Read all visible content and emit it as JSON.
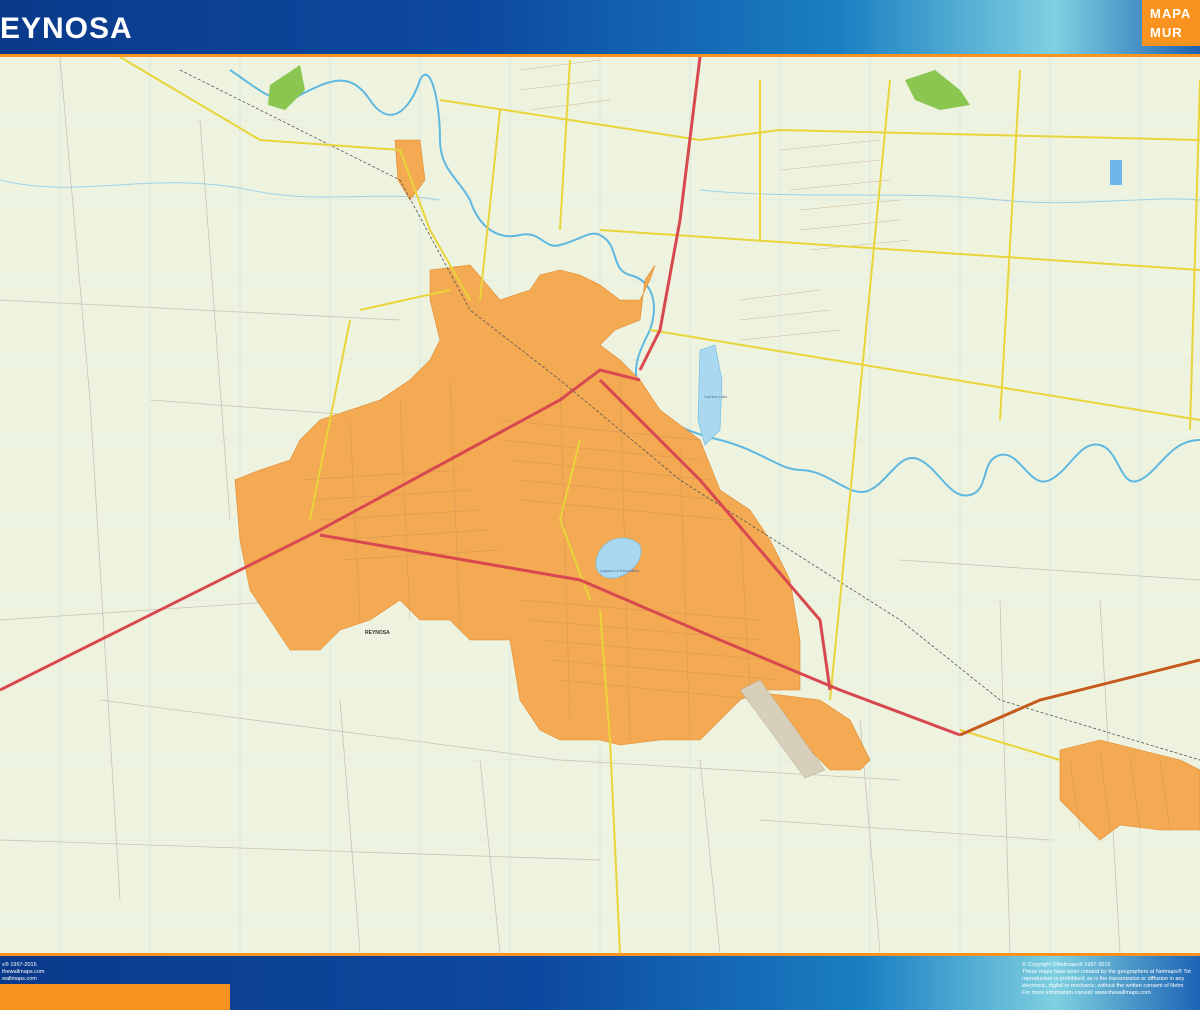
{
  "header": {
    "title": "EYNOSA",
    "brand_line1": "MAPA",
    "brand_line2": "MUR"
  },
  "map": {
    "labels": {
      "city": "REYNOSA",
      "lake": "Laguna La Escondida",
      "lake_north": "Carrera Lake"
    }
  },
  "footer": {
    "left_lines": [
      "s® 1997-2015",
      "thewallmaps.com",
      "wallmaps.com"
    ],
    "right_lines": [
      "© Copyright ©Netmaps® 1997-2015",
      "These maps have been created by the geographers at Netmaps® Tot",
      "reproduction is prohibited; as is the transmission or diffusion in any",
      "electronic, digital or mechanic; without the written consent of Netm",
      "For more information consult: www.thewallmaps.com"
    ]
  },
  "colors": {
    "background": "#eef3df",
    "urban": "#f4a953",
    "water": "#a9d8f0",
    "highway": "#d8484f",
    "main_road": "#e9d43a",
    "accent": "#f7931e",
    "header": "#0d49a0"
  }
}
